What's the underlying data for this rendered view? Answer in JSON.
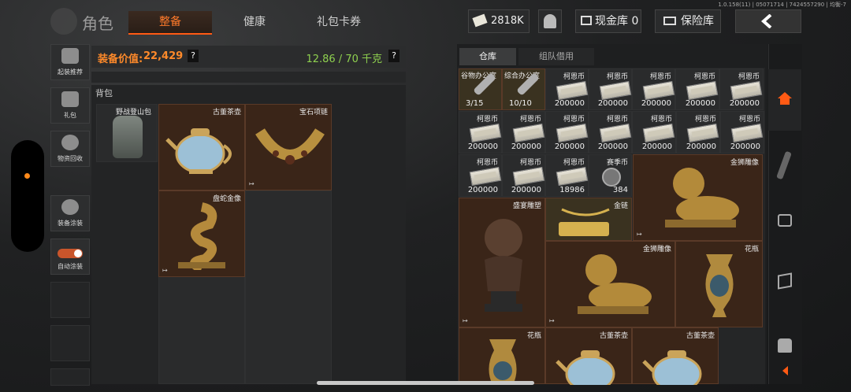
{
  "header": {
    "title": "角色",
    "tabs": [
      {
        "label": "整备",
        "active": true
      },
      {
        "label": "健康",
        "active": false
      },
      {
        "label": "礼包卡券",
        "active": false
      }
    ],
    "currency": "2818K",
    "cash_vault": "现金库 0",
    "safe": "保险库",
    "version": "1.0.158(11) | 05071714 | 7424557290 | 均衡-7"
  },
  "left_menu": [
    {
      "label": "起装推荐",
      "icon": "gear-recommend-icon"
    },
    {
      "label": "礼包",
      "icon": "gift-icon"
    },
    {
      "label": "物资回收",
      "icon": "recycle-icon"
    },
    {
      "label": "装备涂装",
      "icon": "skin-paint-icon"
    },
    {
      "label": "自动涂装",
      "icon": "toggle-icon"
    }
  ],
  "equipment": {
    "value_label": "装备价值:",
    "value": "22,429",
    "help": "?",
    "weight": "12.86 / 70 千克"
  },
  "backpack": {
    "label": "背包",
    "bag_name": "野战登山包",
    "items": [
      {
        "name": "古董茶壶",
        "icon": "teapot-icon"
      },
      {
        "name": "宝石项链",
        "icon": "necklace-icon"
      },
      {
        "name": "盘蛇金像",
        "icon": "snake-statue-icon"
      }
    ]
  },
  "warehouse": {
    "tabs": [
      {
        "label": "仓库",
        "active": true
      },
      {
        "label": "组队借用",
        "active": false
      }
    ],
    "keys": [
      {
        "name": "谷物办公室",
        "count": "3/15"
      },
      {
        "name": "综合办公室",
        "count": "10/10"
      }
    ],
    "coin_name": "柯恩币",
    "coin_stack": "200000",
    "coin_partial": "18986",
    "season_coin_name": "赛季币",
    "season_coin_count": "384",
    "big_items": [
      {
        "name": "金狮雕像"
      },
      {
        "name": "盛宴雕塑"
      },
      {
        "name": "金链"
      },
      {
        "name": "金狮雕像"
      },
      {
        "name": "花瓶"
      },
      {
        "name": "花瓶"
      },
      {
        "name": "古董茶壶"
      },
      {
        "name": "古董茶壶"
      }
    ]
  },
  "colors": {
    "accent": "#ff5a14",
    "value_orange": "#ff8a2a",
    "weight_green": "#8fd14f",
    "item_bg": "#3a2518"
  }
}
